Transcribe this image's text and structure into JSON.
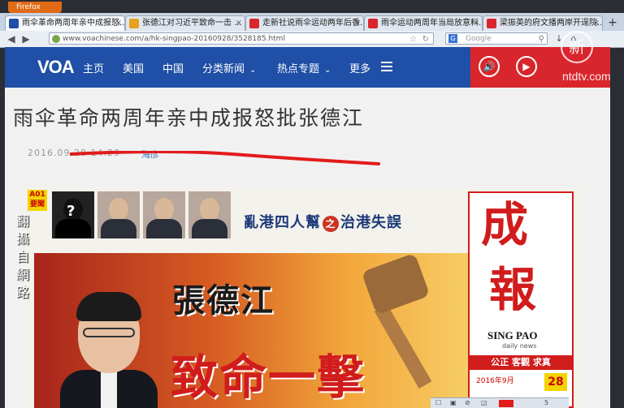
{
  "browser": {
    "menu_button": "Firefox",
    "tabs": [
      {
        "label": "雨伞革命两周年亲中成报怒...",
        "favicon_color": "#1f4fa6",
        "active": true
      },
      {
        "label": "张德江对习近平致命一击 ...",
        "favicon_color": "#e7a11d",
        "active": false
      },
      {
        "label": "走新社说雨伞运动两年后香...",
        "favicon_color": "#d8262c",
        "active": false
      },
      {
        "label": "雨伞运动两周年当局放意料...",
        "favicon_color": "#d8262c",
        "active": false
      },
      {
        "label": "梁振英的府文播两岸开逞院...",
        "favicon_color": "#d8262c",
        "active": false
      }
    ],
    "tab_close": "×",
    "new_tab": "+",
    "url": "www.voachinese.com/a/hk-singpao-20160928/3528185.html",
    "search_placeholder": "Google",
    "back": "◀",
    "forward": "▶",
    "bookmark_star": "☆",
    "reload": "↻",
    "home": "⌂",
    "download": "↓"
  },
  "voa": {
    "logo": "VOA",
    "nav": [
      "主页",
      "美国",
      "中国",
      "分类新闻",
      "热点专题",
      "更多"
    ],
    "chevron": "⌄",
    "audio_icon": "🔊",
    "play_icon": "▶"
  },
  "article": {
    "headline": "雨伞革命两周年亲中成报怒批张德江",
    "date": "2016.09.28 14:29",
    "author": "海彦"
  },
  "newspaper": {
    "page_tag": "A01 要聞",
    "unknown_mark": "?",
    "subhead_left": "亂港四人幫",
    "subhead_zhi": "之",
    "subhead_right": "治港失誤",
    "headline_black": "張德江",
    "headline_red": "致命一擊",
    "masthead_cheng": "成",
    "masthead_bao": "報",
    "masthead_en": "SING PAO",
    "masthead_en2": "daily news",
    "masthead_motto": "公正 客觀 求真",
    "masthead_date": "2016年9月",
    "masthead_day": "28"
  },
  "overlay": {
    "side_label": "翻攝自網路",
    "ntd_glyph": "新",
    "ntd_text": "ntdtv.com"
  },
  "bottom_bar": {
    "items": [
      "☐",
      "▣",
      "⊘",
      "◲",
      "5"
    ]
  }
}
